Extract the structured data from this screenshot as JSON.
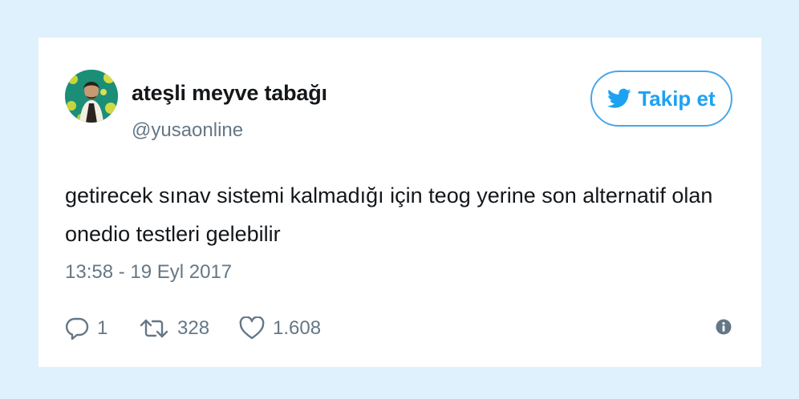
{
  "tweet": {
    "display_name": "ateşli meyve tabağı",
    "handle": "@yusaonline",
    "text": "getirecek sınav sistemi kalmadığı için teog yerine son alternatif olan onedio testleri gelebilir",
    "timestamp": "13:58 - 19 Eyl 2017",
    "avatar_icon": "profile-avatar"
  },
  "follow_button": {
    "label": "Takip et",
    "icon": "twitter-bird-icon"
  },
  "actions": {
    "reply": {
      "icon": "reply-icon",
      "count": "1"
    },
    "retweet": {
      "icon": "retweet-icon",
      "count": "328"
    },
    "like": {
      "icon": "heart-icon",
      "count": "1.608"
    },
    "info": {
      "icon": "info-icon"
    }
  },
  "colors": {
    "background": "#def1fc",
    "card": "#ffffff",
    "text_primary": "#14171a",
    "text_secondary": "#657786",
    "accent": "#1da1f2"
  }
}
